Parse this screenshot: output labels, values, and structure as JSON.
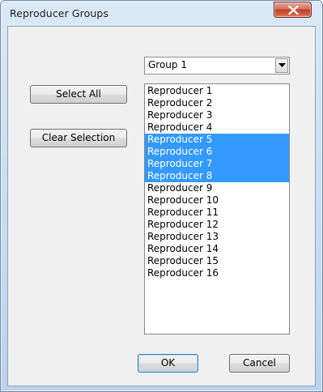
{
  "window": {
    "title": "Reproducer Groups"
  },
  "buttons": {
    "select_all": "Select All",
    "clear_selection": "Clear Selection",
    "ok": "OK",
    "cancel": "Cancel"
  },
  "group_select": {
    "value": "Group 1"
  },
  "reproducers": [
    {
      "label": "Reproducer 1",
      "selected": false
    },
    {
      "label": "Reproducer 2",
      "selected": false
    },
    {
      "label": "Reproducer 3",
      "selected": false
    },
    {
      "label": "Reproducer 4",
      "selected": false
    },
    {
      "label": "Reproducer 5",
      "selected": true
    },
    {
      "label": "Reproducer 6",
      "selected": true
    },
    {
      "label": "Reproducer 7",
      "selected": true
    },
    {
      "label": "Reproducer 8",
      "selected": true
    },
    {
      "label": "Reproducer 9",
      "selected": false
    },
    {
      "label": "Reproducer 10",
      "selected": false
    },
    {
      "label": "Reproducer 11",
      "selected": false
    },
    {
      "label": "Reproducer 12",
      "selected": false
    },
    {
      "label": "Reproducer 13",
      "selected": false
    },
    {
      "label": "Reproducer 14",
      "selected": false
    },
    {
      "label": "Reproducer 15",
      "selected": false
    },
    {
      "label": "Reproducer 16",
      "selected": false
    }
  ],
  "colors": {
    "selection": "#3399ff",
    "selection_text": "#ffffff",
    "close_button": "#c2412c"
  },
  "icons": {
    "close": "close-icon",
    "dropdown": "chevron-down-icon"
  }
}
